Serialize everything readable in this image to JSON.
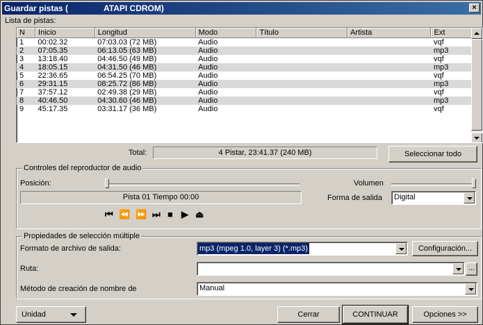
{
  "window": {
    "title_part1": "Guardar pistas (",
    "title_part2": "ATAPI CDROM)"
  },
  "tracklist": {
    "label": "Lista de pistas:",
    "columns": [
      "N",
      "Inicio",
      "Longitud",
      "Modo",
      "Título",
      "Artista",
      "Ext"
    ],
    "rows": [
      [
        "1",
        "00:02.32",
        "07:03.03 (72 MB)",
        "Audio",
        "",
        "",
        "vqf"
      ],
      [
        "2",
        "07:05.35",
        "06:13.05 (63 MB)",
        "Audio",
        "",
        "",
        "mp3"
      ],
      [
        "3",
        "13:18.40",
        "04:46.50 (49 MB)",
        "Audio",
        "",
        "",
        "vqf"
      ],
      [
        "4",
        "18:05.15",
        "04:31.50 (46 MB)",
        "Audio",
        "",
        "",
        "mp3"
      ],
      [
        "5",
        "22:36.65",
        "06:54.25 (70 MB)",
        "Audio",
        "",
        "",
        "vqf"
      ],
      [
        "6",
        "29:31.15",
        "08:25.72 (86 MB)",
        "Audio",
        "",
        "",
        "mp3"
      ],
      [
        "7",
        "37:57.12",
        "02:49.38 (29 MB)",
        "Audio",
        "",
        "",
        "vqf"
      ],
      [
        "8",
        "40:46.50",
        "04:30.60 (46 MB)",
        "Audio",
        "",
        "",
        "mp3"
      ],
      [
        "9",
        "45:17.35",
        "03:31.17 (36 MB)",
        "Audio",
        "",
        "",
        "vqf"
      ]
    ],
    "total_label": "Total:",
    "total_value": "4 Pistar, 23:41.37 (240 MB)",
    "select_all": "Seleccionar todo"
  },
  "player": {
    "legend": "Controles del reproductor de audio",
    "position_label": "Posición:",
    "volume_label": "Volumen",
    "status": "Pista 01 Tiempo 00:00",
    "output_label": "Forma de salida",
    "output_value": "Digital",
    "icons": [
      "skip-back-icon",
      "rewind-icon",
      "fast-forward-icon",
      "skip-forward-icon",
      "stop-icon",
      "play-icon",
      "eject-icon"
    ]
  },
  "props": {
    "legend": "Propiedades de selección múltiple",
    "format_label": "Formato de archivo de salida:",
    "format_value": "mp3 (mpeg 1.0, layer 3) (*.mp3)",
    "config_button": "Configuración...",
    "path_label": "Ruta:",
    "path_value": "",
    "browse_button": "...",
    "naming_label": "Método de creación de nombre de",
    "naming_value": "Manual"
  },
  "footer": {
    "unit_button": "Unidad",
    "close_button": "Cerrar",
    "continue_button": "CONTINUAR",
    "options_button": "Opciones >>"
  }
}
